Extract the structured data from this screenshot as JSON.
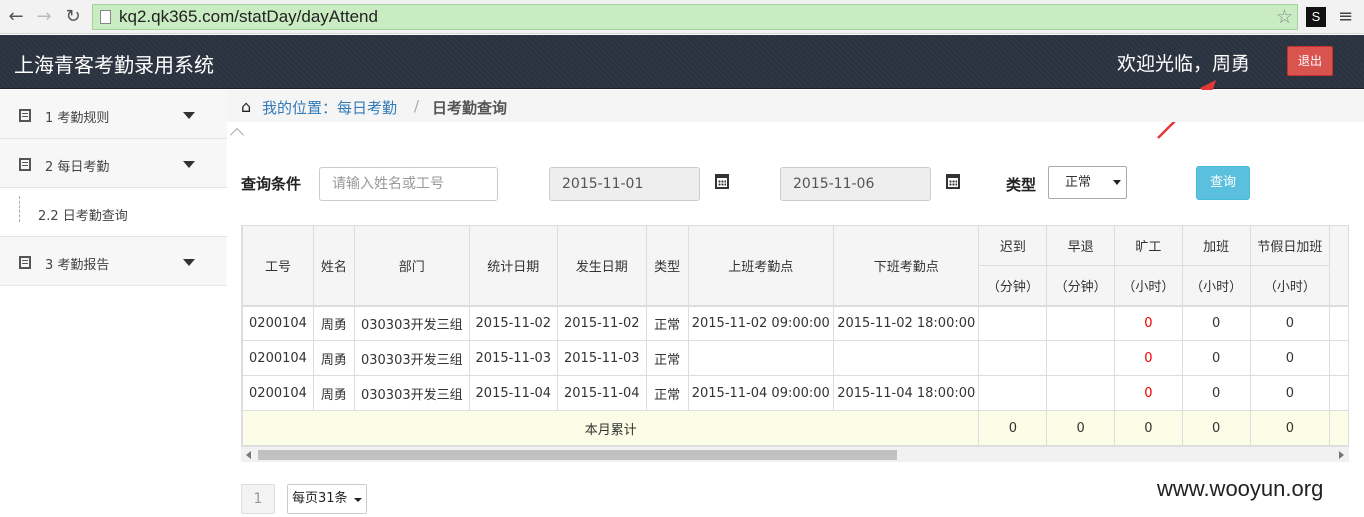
{
  "browser": {
    "url": "kq2.qk365.com/statDay/dayAttend",
    "ext_label": "S"
  },
  "header": {
    "title": "上海青客考勤录用系统",
    "welcome": "欢迎光临，周勇",
    "logout_label": "退出"
  },
  "sidebar": {
    "items": [
      {
        "label": "1 考勤规则"
      },
      {
        "label": "2 每日考勤"
      },
      {
        "label": "2.2 日考勤查询"
      },
      {
        "label": "3 考勤报告"
      }
    ]
  },
  "breadcrumb": {
    "prefix": "我的位置：每日考勤",
    "separator": "/",
    "current": "日考勤查询"
  },
  "query": {
    "label": "查询条件",
    "name_placeholder": "请输入姓名或工号",
    "start_date": "2015-11-01",
    "end_date": "2015-11-06",
    "type_label": "类型",
    "type_value": "正常",
    "submit_label": "查询"
  },
  "table": {
    "headers": [
      "工号",
      "姓名",
      "部门",
      "统计日期",
      "发生日期",
      "类型",
      "上班考勤点",
      "下班考勤点",
      "迟到",
      "早退",
      "旷工",
      "加班",
      "节假日加班"
    ],
    "subheaders": [
      "（分钟）",
      "（分钟）",
      "（小时）",
      "（小时）",
      "（小时）"
    ],
    "rows": [
      [
        "0200104",
        "周勇",
        "030303开发三组",
        "2015-11-02",
        "2015-11-02",
        "正常",
        "2015-11-02 09:00:00",
        "2015-11-02 18:00:00",
        "",
        "",
        "0",
        "0",
        "0"
      ],
      [
        "0200104",
        "周勇",
        "030303开发三组",
        "2015-11-03",
        "2015-11-03",
        "正常",
        "",
        "",
        "",
        "",
        "0",
        "0",
        "0"
      ],
      [
        "0200104",
        "周勇",
        "030303开发三组",
        "2015-11-04",
        "2015-11-04",
        "正常",
        "2015-11-04 09:00:00",
        "2015-11-04 18:00:00",
        "",
        "",
        "0",
        "0",
        "0"
      ]
    ],
    "total_label": "本月累计",
    "totals": [
      "0",
      "0",
      "0",
      "0",
      "0"
    ]
  },
  "pagination": {
    "current_page": "1",
    "page_size_label": "每页31条"
  },
  "watermark": "www.wooyun.org",
  "colors": {
    "header_bg": "#2b3340",
    "logout_btn": "#d9534f",
    "query_btn": "#5bc0de",
    "url_bar": "#c9ecc2",
    "absent_value": "#ee0000"
  }
}
